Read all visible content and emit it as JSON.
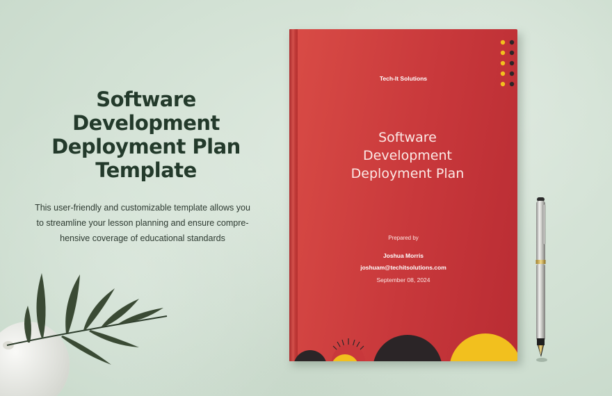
{
  "headline": {
    "line1": "Software",
    "line2": "Development",
    "line3": "Deployment Plan",
    "line4": "Template"
  },
  "description": {
    "line1": "This user-friendly and customizable template allows you",
    "line2": "to streamline your lesson planning and ensure compre-",
    "line3": "hensive coverage of educational standards"
  },
  "cover": {
    "company": "Tech-It Solutions",
    "title_line1": "Software",
    "title_line2": "Development",
    "title_line3": "Deployment Plan",
    "prepared_by_label": "Prepared by",
    "author_name": "Joshua Morris",
    "author_email": "joshuam@techitsolutions.com",
    "date": "September 08, 2024"
  },
  "colors": {
    "background": "#d6e4d8",
    "headline_text": "#233a2b",
    "cover_red": "#c8383b",
    "accent_yellow": "#f2c01e",
    "accent_dark": "#2b2527"
  },
  "icons": {
    "decor_dots": "dot-grid",
    "pen": "fountain-pen",
    "plant": "vase-with-leaves"
  }
}
